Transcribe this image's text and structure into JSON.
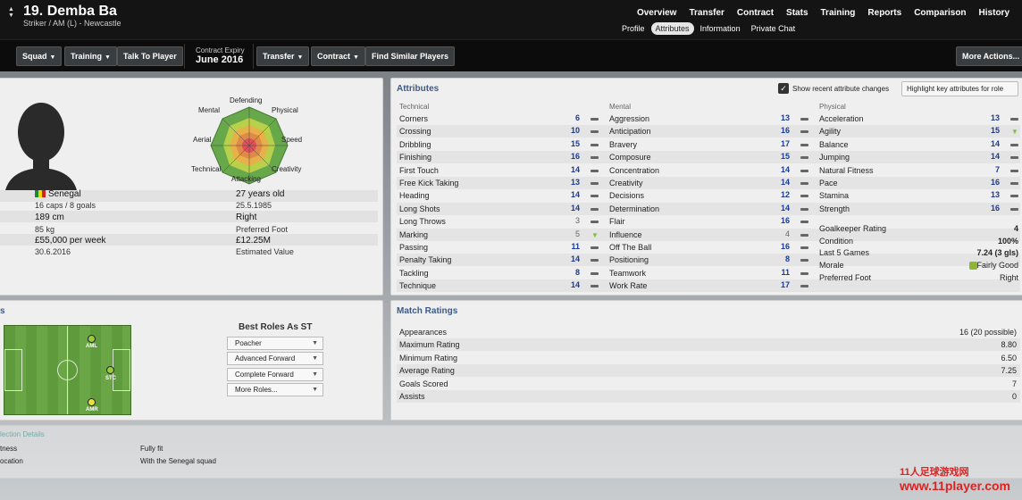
{
  "header": {
    "player_name": "19. Demba Ba",
    "player_subtitle": "Striker / AM (L) - Newcastle",
    "top_nav": [
      "Overview",
      "Transfer",
      "Contract",
      "Stats",
      "Training",
      "Reports",
      "Comparison",
      "History"
    ],
    "sub_nav": [
      "Profile",
      "Attributes",
      "Information",
      "Private Chat"
    ],
    "sub_nav_active": "Attributes"
  },
  "toolbar": {
    "squad": "Squad",
    "training": "Training",
    "talk": "Talk To Player",
    "contract_expiry_label": "Contract Expiry",
    "contract_expiry_value": "June 2016",
    "transfer": "Transfer",
    "contract": "Contract",
    "find_similar": "Find Similar Players",
    "more_actions": "More Actions..."
  },
  "profile": {
    "nationality": "Senegal",
    "caps": "16 caps / 8 goals",
    "height": "189 cm",
    "weight": "85 kg",
    "wage": "£55,000 per week",
    "contract_end": "30.6.2016",
    "age": "27 years old",
    "dob": "25.5.1985",
    "foot": "Right",
    "foot_label": "Preferred Foot",
    "value": "£12.25M",
    "value_label": "Estimated Value",
    "radar_labels": {
      "defending": "Defending",
      "physical": "Physical",
      "speed": "Speed",
      "creativity": "Creativity",
      "attacking": "Attacking",
      "technical": "Technical",
      "aerial": "Aerial",
      "mental": "Mental"
    }
  },
  "attributes": {
    "title": "Attributes",
    "show_recent_label": "Show recent attribute changes",
    "highlight_button": "Highlight key attributes for role",
    "technical_header": "Technical",
    "mental_header": "Mental",
    "physical_header": "Physical",
    "technical": [
      {
        "name": "Corners",
        "value": "6",
        "trend": "bar"
      },
      {
        "name": "Crossing",
        "value": "10",
        "trend": "bar"
      },
      {
        "name": "Dribbling",
        "value": "15",
        "trend": "bar"
      },
      {
        "name": "Finishing",
        "value": "16",
        "trend": "bar"
      },
      {
        "name": "First Touch",
        "value": "14",
        "trend": "bar"
      },
      {
        "name": "Free Kick Taking",
        "value": "13",
        "trend": "bar"
      },
      {
        "name": "Heading",
        "value": "14",
        "trend": "bar"
      },
      {
        "name": "Long Shots",
        "value": "14",
        "trend": "bar"
      },
      {
        "name": "Long Throws",
        "value": "3",
        "trend": "bar"
      },
      {
        "name": "Marking",
        "value": "5",
        "trend": "up"
      },
      {
        "name": "Passing",
        "value": "11",
        "trend": "bar"
      },
      {
        "name": "Penalty Taking",
        "value": "14",
        "trend": "bar"
      },
      {
        "name": "Tackling",
        "value": "8",
        "trend": "bar"
      },
      {
        "name": "Technique",
        "value": "14",
        "trend": "bar"
      }
    ],
    "mental": [
      {
        "name": "Aggression",
        "value": "13",
        "trend": "bar"
      },
      {
        "name": "Anticipation",
        "value": "16",
        "trend": "bar"
      },
      {
        "name": "Bravery",
        "value": "17",
        "trend": "bar"
      },
      {
        "name": "Composure",
        "value": "15",
        "trend": "bar"
      },
      {
        "name": "Concentration",
        "value": "14",
        "trend": "bar"
      },
      {
        "name": "Creativity",
        "value": "14",
        "trend": "bar"
      },
      {
        "name": "Decisions",
        "value": "12",
        "trend": "bar"
      },
      {
        "name": "Determination",
        "value": "14",
        "trend": "bar"
      },
      {
        "name": "Flair",
        "value": "16",
        "trend": "bar"
      },
      {
        "name": "Influence",
        "value": "4",
        "trend": "bar"
      },
      {
        "name": "Off The Ball",
        "value": "16",
        "trend": "bar"
      },
      {
        "name": "Positioning",
        "value": "8",
        "trend": "bar"
      },
      {
        "name": "Teamwork",
        "value": "11",
        "trend": "bar"
      },
      {
        "name": "Work Rate",
        "value": "17",
        "trend": "bar"
      }
    ],
    "physical": [
      {
        "name": "Acceleration",
        "value": "13",
        "trend": "bar"
      },
      {
        "name": "Agility",
        "value": "15",
        "trend": "up"
      },
      {
        "name": "Balance",
        "value": "14",
        "trend": "bar"
      },
      {
        "name": "Jumping",
        "value": "14",
        "trend": "bar"
      },
      {
        "name": "Natural Fitness",
        "value": "7",
        "trend": "bar"
      },
      {
        "name": "Pace",
        "value": "16",
        "trend": "bar"
      },
      {
        "name": "Stamina",
        "value": "13",
        "trend": "bar"
      },
      {
        "name": "Strength",
        "value": "16",
        "trend": "bar"
      }
    ],
    "misc": [
      {
        "name": "Goalkeeper Rating",
        "value": "4"
      },
      {
        "name": "Condition",
        "value": "100%"
      },
      {
        "name": "Last 5 Games",
        "value": "7.24 (3 gls)"
      },
      {
        "name": "Morale",
        "value": "Fairly Good"
      },
      {
        "name": "Preferred Foot",
        "value": "Right"
      }
    ]
  },
  "positions": {
    "best_roles_title": "Best Roles As ST",
    "roles": [
      "Poacher",
      "Advanced Forward",
      "Complete Forward",
      "More Roles..."
    ],
    "pitch_labels": [
      "AML",
      "STC",
      "AMR"
    ]
  },
  "match_ratings": {
    "title": "Match Ratings",
    "rows": [
      {
        "name": "Appearances",
        "value": "16 (20 possible)"
      },
      {
        "name": "Maximum Rating",
        "value": "8.80"
      },
      {
        "name": "Minimum Rating",
        "value": "6.50"
      },
      {
        "name": "Average Rating",
        "value": "7.25"
      },
      {
        "name": "Goals Scored",
        "value": "7"
      },
      {
        "name": "Assists",
        "value": "0"
      }
    ]
  },
  "selection": {
    "title": "lection Details",
    "fitness_label": "tness",
    "fitness_value": "Fully fit",
    "location_label": "ocation",
    "location_value": "With the Senegal squad"
  },
  "watermark": {
    "line1": "11人足球游戏网",
    "line2": "www.11player.com"
  },
  "colors": {
    "accent_blue": "#3b5a8a",
    "attr_value": "#1a3a9a",
    "trend_up": "#7cc03a"
  }
}
